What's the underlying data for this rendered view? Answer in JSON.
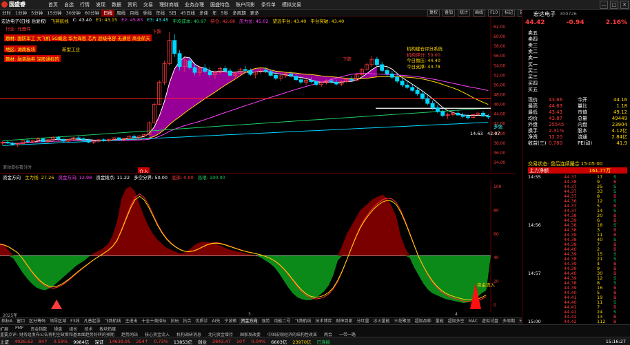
{
  "app": {
    "name": "国盛睿",
    "menu": [
      "首页",
      "自选",
      "行情",
      "发现",
      "数据",
      "资讯",
      "交易",
      "理财商城",
      "业务办理",
      "国盛特色",
      "账户问影",
      "条件单",
      "模拟交易"
    ],
    "window_ctrls": [
      "—",
      "□",
      "✕"
    ]
  },
  "period": {
    "items": [
      "分时",
      "1分钟",
      "5分钟",
      "15分钟",
      "30分钟",
      "60分钟",
      "日线",
      "周线",
      "月线",
      "季线",
      "年线",
      "5日",
      "45日线",
      "多佳",
      "年",
      "5秒",
      "多周期",
      "更多"
    ],
    "active_index": 6
  },
  "tools": [
    "复权",
    "叠加",
    "统计",
    "画线",
    "F10",
    "标记",
    "自选",
    "返回"
  ],
  "chart": {
    "info": {
      "name": "宏达电子(日线 后复权)",
      "indicator": "飞燕航线",
      "c": "C: 43.40",
      "e": "E1: 43.15",
      "e2": "E2: 45.83",
      "e3": "E3: 43.45",
      "avgcost": "平均成本: 40.97",
      "hold": "持仓: 42.68",
      "breakline": "压力位: 45.02",
      "expect": "望远平台: 43.40",
      "flat": "平台突破: 43.40"
    },
    "notes": {
      "industry": "行业: 元器件",
      "concept": "题材: 国防军工 大飞机 5G概念 华为海思 芯片 超级电容 无通信 商业航天",
      "region": "地区: 湖南板块",
      "style": "题材: 融资融券 深股通标的",
      "new": "新型工业",
      "box_title": "机构建仓评分系统",
      "box_l1": "机构评分: 50.00",
      "box_l2": "今日抛压: 44.40",
      "box_l3": "今日支撑: 43.78",
      "low_label": "下跌",
      "hi_label": "下跌",
      "buy_label": "介入",
      "buy2_label": "B",
      "low_price": "14.63",
      "hi_price": "42.07",
      "bottom_label": "多强"
    },
    "hint": "滚动鼠标看分时",
    "yaxis": [
      "62.00",
      "60.00",
      "58.00",
      "56.00",
      "54.00",
      "52.00",
      "50.00",
      "48.00",
      "46.00",
      "44.00",
      "42.00",
      "40.00",
      "38.00",
      "36.00",
      "34.00"
    ],
    "colors": {
      "up": "#ff3b3b",
      "down": "#00d6ff",
      "fill": "#c000c0"
    }
  },
  "chart_data": {
    "type": "candlestick",
    "title": "宏达电子(日线 后复权)",
    "ylim": [
      34,
      63
    ],
    "candles": [
      [
        38.0,
        38.4,
        37.6,
        38.2
      ],
      [
        38.2,
        38.6,
        37.9,
        38.0
      ],
      [
        38.0,
        38.3,
        37.5,
        37.7
      ],
      [
        37.7,
        38.0,
        37.2,
        37.9
      ],
      [
        37.9,
        38.6,
        37.8,
        38.5
      ],
      [
        38.5,
        39.0,
        38.1,
        38.3
      ],
      [
        38.3,
        38.7,
        38.0,
        38.6
      ],
      [
        38.6,
        39.2,
        38.4,
        38.9
      ],
      [
        38.9,
        39.1,
        38.2,
        38.3
      ],
      [
        38.3,
        38.8,
        38.0,
        38.7
      ],
      [
        38.7,
        39.4,
        38.5,
        39.2
      ],
      [
        39.2,
        39.5,
        38.6,
        38.8
      ],
      [
        38.8,
        39.0,
        38.1,
        38.4
      ],
      [
        38.4,
        38.9,
        38.2,
        38.8
      ],
      [
        38.8,
        39.3,
        38.6,
        39.1
      ],
      [
        39.1,
        39.4,
        38.7,
        38.9
      ],
      [
        38.9,
        39.2,
        38.4,
        38.6
      ],
      [
        38.6,
        38.9,
        38.0,
        38.2
      ],
      [
        38.2,
        38.6,
        37.8,
        38.4
      ],
      [
        38.4,
        38.8,
        38.1,
        38.7
      ],
      [
        38.7,
        39.0,
        38.3,
        38.5
      ],
      [
        38.5,
        38.9,
        38.2,
        38.8
      ],
      [
        38.8,
        39.3,
        38.6,
        39.1
      ],
      [
        39.1,
        39.3,
        38.6,
        38.7
      ],
      [
        38.7,
        39.1,
        38.4,
        39.0
      ],
      [
        39.0,
        39.6,
        38.8,
        39.4
      ],
      [
        39.4,
        39.8,
        39.0,
        39.2
      ],
      [
        39.2,
        39.6,
        38.8,
        39.5
      ],
      [
        39.5,
        40.0,
        39.2,
        39.8
      ],
      [
        39.8,
        42.5,
        39.6,
        42.2
      ],
      [
        42.2,
        46.4,
        42.0,
        46.0
      ],
      [
        46.0,
        51.0,
        45.8,
        50.6
      ],
      [
        50.6,
        55.0,
        50.0,
        54.4
      ],
      [
        54.4,
        61.0,
        54.0,
        59.2
      ],
      [
        59.2,
        60.5,
        55.8,
        56.5
      ],
      [
        56.5,
        57.2,
        53.0,
        53.8
      ],
      [
        53.8,
        55.6,
        52.6,
        55.0
      ],
      [
        55.0,
        55.8,
        53.2,
        53.6
      ],
      [
        53.6,
        54.6,
        52.0,
        52.6
      ],
      [
        52.6,
        53.9,
        51.8,
        53.5
      ],
      [
        53.5,
        54.3,
        52.4,
        52.8
      ],
      [
        52.8,
        53.6,
        51.6,
        52.1
      ],
      [
        52.1,
        53.0,
        51.2,
        52.6
      ],
      [
        52.6,
        53.8,
        52.2,
        53.4
      ],
      [
        53.4,
        54.0,
        52.6,
        52.9
      ],
      [
        52.9,
        53.4,
        51.8,
        52.0
      ],
      [
        52.0,
        52.8,
        51.2,
        52.4
      ],
      [
        52.4,
        53.6,
        52.0,
        53.2
      ],
      [
        53.2,
        53.9,
        52.6,
        53.0
      ],
      [
        53.0,
        53.4,
        51.9,
        52.2
      ],
      [
        52.2,
        52.9,
        51.4,
        52.7
      ],
      [
        52.7,
        53.5,
        52.2,
        53.1
      ],
      [
        53.1,
        53.6,
        52.5,
        52.8
      ],
      [
        52.8,
        53.1,
        51.8,
        52.0
      ],
      [
        52.0,
        52.6,
        51.0,
        51.4
      ],
      [
        51.4,
        52.2,
        50.8,
        51.9
      ],
      [
        51.9,
        52.6,
        51.5,
        52.3
      ],
      [
        52.3,
        52.8,
        51.6,
        51.8
      ],
      [
        51.8,
        52.2,
        50.8,
        51.1
      ],
      [
        51.1,
        51.7,
        50.2,
        50.6
      ],
      [
        50.6,
        51.3,
        50.0,
        51.0
      ],
      [
        51.0,
        51.6,
        50.4,
        50.7
      ],
      [
        50.7,
        51.0,
        49.8,
        50.1
      ],
      [
        50.1,
        50.8,
        49.6,
        50.5
      ],
      [
        50.5,
        51.2,
        50.1,
        50.9
      ],
      [
        50.9,
        51.4,
        50.3,
        50.6
      ],
      [
        50.6,
        51.0,
        49.9,
        50.2
      ],
      [
        50.2,
        50.9,
        49.8,
        50.7
      ],
      [
        50.7,
        51.5,
        50.4,
        51.2
      ],
      [
        51.2,
        51.8,
        50.6,
        51.0
      ],
      [
        51.0,
        52.4,
        50.8,
        52.1
      ],
      [
        52.1,
        53.5,
        51.9,
        53.2
      ],
      [
        53.2,
        54.6,
        53.0,
        54.2
      ],
      [
        54.2,
        56.0,
        53.8,
        55.3
      ],
      [
        55.3,
        55.8,
        53.9,
        54.2
      ],
      [
        54.2,
        54.8,
        52.6,
        53.0
      ],
      [
        53.0,
        53.6,
        51.8,
        52.3
      ],
      [
        52.3,
        52.9,
        51.2,
        51.6
      ],
      [
        51.6,
        52.2,
        50.4,
        50.8
      ],
      [
        50.8,
        51.4,
        49.6,
        50.0
      ],
      [
        50.0,
        50.8,
        49.2,
        49.5
      ],
      [
        49.5,
        50.1,
        48.6,
        48.9
      ],
      [
        48.9,
        49.4,
        47.8,
        48.2
      ],
      [
        48.2,
        48.8,
        46.9,
        47.2
      ],
      [
        47.2,
        47.9,
        45.8,
        46.2
      ],
      [
        46.2,
        46.8,
        44.9,
        45.3
      ],
      [
        45.3,
        45.9,
        44.2,
        44.5
      ],
      [
        44.5,
        45.0,
        43.4,
        43.7
      ],
      [
        43.7,
        44.3,
        43.0,
        43.9
      ],
      [
        43.9,
        44.6,
        43.5,
        44.2
      ],
      [
        44.2,
        44.8,
        43.6,
        43.8
      ],
      [
        43.8,
        44.3,
        43.2,
        43.5
      ],
      [
        43.5,
        44.0,
        42.9,
        43.3
      ],
      [
        43.3,
        44.1,
        43.1,
        43.9
      ],
      [
        43.9,
        44.5,
        43.6,
        44.2
      ],
      [
        44.2,
        44.6,
        43.4,
        43.6
      ],
      [
        43.6,
        44.0,
        43.0,
        43.4
      ]
    ]
  },
  "indicator": {
    "title": "资金方向",
    "items": [
      {
        "label": "主力线: 27.26",
        "color": "#ffd700"
      },
      {
        "label": "资金方向: 12.98",
        "color": "#ff40ff"
      },
      {
        "label": "资金拨点: 11.22",
        "color": "#ffffff"
      },
      {
        "label": "多空分界: 50.00",
        "color": "#ffffff"
      },
      {
        "label": "底部: 0.00",
        "color": "#ff3b3b"
      },
      {
        "label": "高限: 100.00",
        "color": "#20d060"
      }
    ],
    "buy_label": "资金流入",
    "yaxis": [
      "100",
      "80",
      "60",
      "40",
      "20",
      "0"
    ]
  },
  "osc_data": [
    62,
    60,
    55,
    47,
    40,
    33,
    27,
    22,
    18,
    16,
    15,
    17,
    20,
    24,
    28,
    32,
    36,
    40,
    43,
    46,
    50,
    53,
    55,
    58,
    62,
    70,
    85,
    108,
    118,
    120,
    115,
    102,
    90,
    80,
    72,
    66,
    62,
    58,
    56,
    54,
    52,
    53,
    56,
    60,
    63,
    64,
    64,
    63,
    62,
    60,
    58,
    56,
    55,
    54,
    53,
    52,
    51,
    50,
    48,
    45,
    42,
    38,
    32,
    25,
    18,
    12,
    8,
    6,
    5,
    5,
    7,
    10,
    14,
    20,
    30,
    45,
    60,
    72,
    80,
    88,
    96,
    100,
    104,
    108,
    110,
    112,
    108,
    100,
    90,
    70,
    58,
    48,
    38,
    30,
    22,
    16,
    12,
    10,
    8,
    6,
    5,
    4,
    3,
    2,
    3,
    5,
    8,
    12,
    15
  ],
  "dates": {
    "y2025": "2025年",
    "m3": "3",
    "m4": "4"
  },
  "tabs": {
    "items": [
      "指标A",
      "窗口",
      "区分筹码",
      "领导区域",
      "F3线",
      "凡普起涨",
      "飞燕航线",
      "主进出",
      "十全十美指标",
      "抗玩",
      "抗合",
      "优质诊",
      "AI先",
      "宁波赖",
      "资金方向",
      "强势",
      "动能二号",
      "飞燕航线",
      "技术博弈",
      "财神到家",
      "分红量",
      "冰火量能",
      "三花聚顶",
      "超级品种",
      "量能",
      "超级多空",
      "MAC",
      "虚拟试盘",
      "多周期",
      "分交易",
      "划分",
      "班级统计"
    ],
    "active_index": 14
  },
  "ticker": {
    "l1": [
      "扩展",
      "PMF",
      "资金指数",
      "操盘",
      "组长",
      "技术",
      "板块热度"
    ],
    "l2": [
      "重要点评: 财务组发布公告将利空政策和基本面趋势好转的预期",
      "趋势网站",
      "核心资金流入",
      "机构调研消息",
      "北向资金增持",
      "国家发改委",
      "中国宏观经济的结构性改革",
      "两会",
      "一带一路"
    ]
  },
  "status": {
    "sh_label": "上证",
    "sh_val": "4026.63",
    "sh_chg": "84↑",
    "sh_pct": "0.59%",
    "sh_amt": "9984亿",
    "sz_label": "深证",
    "sz_val": "14639.95",
    "sz_chg": "254↑",
    "sz_pct": "0.73%",
    "sz_amt": "13853亿",
    "cy_label": "创业",
    "cy_val": "2843.47",
    "cy_chg": "10↑",
    "cy_pct": "0.04%",
    "cy_amt": "6603亿",
    "total": "23970亿",
    "conn": "已连接",
    "time": "15:16:27"
  },
  "quote": {
    "name": "宏达电子",
    "code": "300726",
    "price": "44.42",
    "change": "-0.94",
    "pct": "2.16%",
    "asks": [
      {
        "l": "卖五",
        "p": "",
        "v": ""
      },
      {
        "l": "卖四",
        "p": "",
        "v": ""
      },
      {
        "l": "卖三",
        "p": "",
        "v": ""
      },
      {
        "l": "卖二",
        "p": "",
        "v": ""
      },
      {
        "l": "卖一",
        "p": "",
        "v": ""
      }
    ],
    "bids": [
      {
        "l": "买一",
        "p": "",
        "v": ""
      },
      {
        "l": "买二",
        "p": "",
        "v": ""
      },
      {
        "l": "买三",
        "p": "",
        "v": ""
      },
      {
        "l": "买四",
        "p": "",
        "v": ""
      },
      {
        "l": "买五",
        "p": "",
        "v": ""
      }
    ],
    "stats": [
      {
        "k1": "现价",
        "v1": "43.66",
        "k2": "今开",
        "v2": "44.16"
      },
      {
        "k1": "最高",
        "v1": "44.63",
        "k2": "量比",
        "v2": "1.18"
      },
      {
        "k1": "最低",
        "v1": "43.43",
        "k2": "市值",
        "v2": "49.12"
      },
      {
        "k1": "均价",
        "v1": "43.87",
        "k2": "总量",
        "v2": "49449"
      },
      {
        "k1": "外盘",
        "v1": "25545",
        "k2": "内盘",
        "v2": "23904"
      },
      {
        "k1": "换手",
        "v1": "2.31%",
        "k2": "股本",
        "v2": "4.12亿"
      },
      {
        "k1": "净资",
        "v1": "12.20",
        "k2": "流通",
        "v2": "2.84亿"
      },
      {
        "k1": "收益(三)",
        "v1": "0.780",
        "k2": "PE(动)",
        "v2": "41.9"
      }
    ],
    "state": "交易状态: 盘后连续撮合 15:05:00",
    "flow_label": "主力净额",
    "flow_val": "161.77万",
    "trades": [
      {
        "t": "14:55",
        "p": "44.37",
        "v": "17",
        "s": "S"
      },
      {
        "t": "",
        "p": "44.38",
        "v": "9",
        "s": "B"
      },
      {
        "t": "",
        "p": "44.37",
        "v": "25",
        "s": "S"
      },
      {
        "t": "",
        "p": "44.37",
        "v": "33",
        "s": "S"
      },
      {
        "t": "",
        "p": "44.37",
        "v": "8",
        "s": "B"
      },
      {
        "t": "",
        "p": "44.36",
        "v": "12",
        "s": "S"
      },
      {
        "t": "",
        "p": "44.37",
        "v": "5",
        "s": "B"
      },
      {
        "t": "",
        "p": "44.37",
        "v": "14",
        "s": "S"
      },
      {
        "t": "",
        "p": "44.38",
        "v": "20",
        "s": "B"
      },
      {
        "t": "",
        "p": "44.39",
        "v": "6",
        "s": "B"
      },
      {
        "t": "14:56",
        "p": "44.38",
        "v": "18",
        "s": "S"
      },
      {
        "t": "",
        "p": "44.38",
        "v": "3",
        "s": "B"
      },
      {
        "t": "",
        "p": "44.39",
        "v": "11",
        "s": "B"
      },
      {
        "t": "",
        "p": "44.38",
        "v": "40",
        "s": "S"
      },
      {
        "t": "",
        "p": "44.39",
        "v": "7",
        "s": "B"
      },
      {
        "t": "",
        "p": "44.40",
        "v": "2",
        "s": "B"
      },
      {
        "t": "",
        "p": "44.39",
        "v": "15",
        "s": "S"
      },
      {
        "t": "",
        "p": "44.38",
        "v": "21",
        "s": "S"
      },
      {
        "t": "",
        "p": "44.39",
        "v": "4",
        "s": "B"
      },
      {
        "t": "",
        "p": "44.39",
        "v": "9",
        "s": "B"
      },
      {
        "t": "14:57",
        "p": "44.40",
        "v": "30",
        "s": "B"
      },
      {
        "t": "",
        "p": "44.39",
        "v": "12",
        "s": "S"
      },
      {
        "t": "",
        "p": "44.38",
        "v": "8",
        "s": "S"
      },
      {
        "t": "",
        "p": "44.39",
        "v": "16",
        "s": "B"
      },
      {
        "t": "",
        "p": "44.40",
        "v": "5",
        "s": "B"
      },
      {
        "t": "",
        "p": "44.41",
        "v": "19",
        "s": "B"
      },
      {
        "t": "",
        "p": "44.40",
        "v": "11",
        "s": "S"
      },
      {
        "t": "",
        "p": "44.41",
        "v": "7",
        "s": "B"
      },
      {
        "t": "",
        "p": "44.41",
        "v": "24",
        "s": "S"
      },
      {
        "t": "",
        "p": "44.42",
        "v": "13",
        "s": "B"
      },
      {
        "t": "15:00",
        "p": "44.42",
        "v": "112",
        "s": "B"
      }
    ]
  }
}
